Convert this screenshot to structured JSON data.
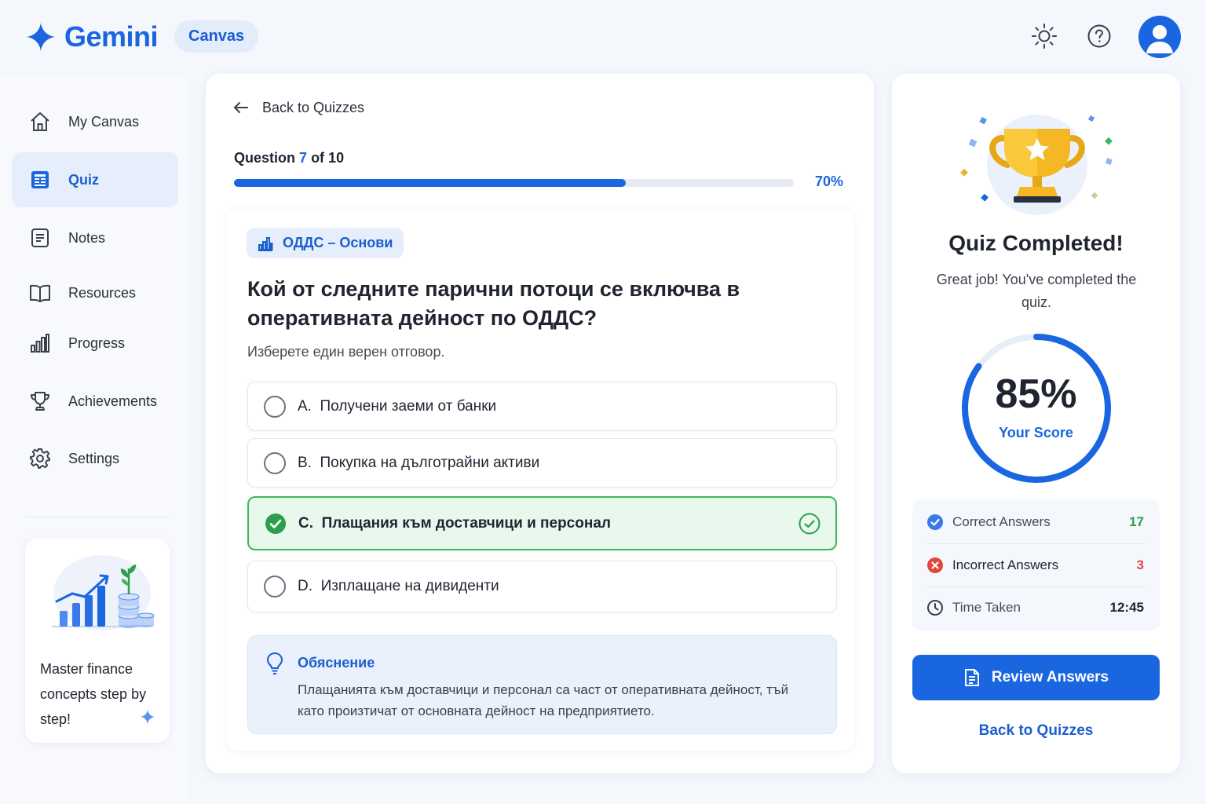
{
  "header": {
    "brand": "Gemini",
    "badge": "Canvas",
    "icons": [
      "sun-icon",
      "help-icon",
      "avatar"
    ]
  },
  "sidebar": {
    "items": [
      {
        "label": "My Canvas",
        "icon": "home-icon"
      },
      {
        "label": "Quiz",
        "icon": "quiz-icon",
        "active": true
      },
      {
        "label": "Notes",
        "icon": "notes-icon"
      },
      {
        "label": "Resources",
        "icon": "book-icon"
      },
      {
        "label": "Progress",
        "icon": "bar-chart-icon"
      },
      {
        "label": "Achievements",
        "icon": "trophy-icon"
      },
      {
        "label": "Settings",
        "icon": "gear-icon"
      }
    ],
    "promo": {
      "text": "Master finance concepts step by step!"
    }
  },
  "main": {
    "back_label": "Back to Quizzes",
    "question_prefix": "Question",
    "question_current": "7",
    "question_of": "of 10",
    "progress_fraction": 0.7,
    "progress_label": "70%",
    "topic": "ОДДС – Основи",
    "question": "Кой от следните парични потоци се включва в оперативната дейност по ОДДС?",
    "hint": "Изберете един верен отговор.",
    "options": [
      {
        "letter": "A.",
        "text": "Получени заеми от банки",
        "correct": false
      },
      {
        "letter": "B.",
        "text": "Покупка на дълготрайни активи",
        "correct": false
      },
      {
        "letter": "C.",
        "text": "Плащания към доставчици и персонал",
        "correct": true
      },
      {
        "letter": "D.",
        "text": "Изплащане на дивиденти",
        "correct": false
      }
    ],
    "explanation": {
      "title": "Обяснение",
      "body": "Плащанията към доставчици и персонал са част от оперативната дейност, тъй като произтичат от основната дейност на предприятието."
    }
  },
  "result": {
    "title": "Quiz Completed!",
    "subtitle": "Great job! You've completed the quiz.",
    "score": "85%",
    "score_fraction": 0.85,
    "score_label": "Your Score",
    "stats": [
      {
        "label": "Correct Answers",
        "value": "17",
        "color": "#2e9e4c",
        "icon": "check-circle-icon"
      },
      {
        "label": "Incorrect Answers",
        "value": "3",
        "color": "#e0463c",
        "icon": "x-circle-icon"
      },
      {
        "label": "Time Taken",
        "value": "12:45",
        "color": "#1f2430",
        "icon": "clock-icon"
      }
    ],
    "review_button": "Review Answers",
    "back_button": "Back to Quizzes"
  },
  "colors": {
    "accent": "#1a66e0",
    "success": "#3cb85a",
    "error": "#e0463c"
  }
}
